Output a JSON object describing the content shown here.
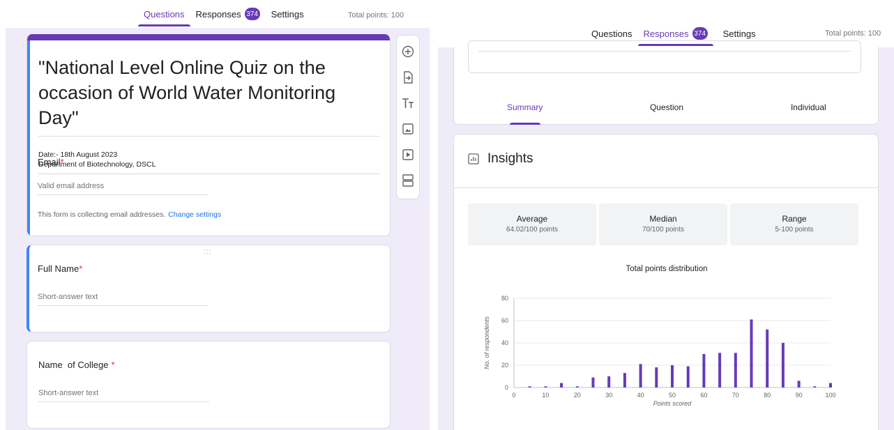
{
  "editor": {
    "tabs": [
      {
        "label": "Questions",
        "active": true
      },
      {
        "label": "Responses",
        "badge": "374",
        "active": false
      },
      {
        "label": "Settings",
        "active": false
      }
    ],
    "total_points": "Total points: 100",
    "form": {
      "title": "\"National Level Online Quiz on the occasion of World Water Monitoring Day\"",
      "description_line1": "Date:- 18th August 2023",
      "description_line2": "Department of Biotechnology, DSCL"
    },
    "email": {
      "label": "Email",
      "required_mark": "*",
      "placeholder": "Valid email address",
      "note": "This form is collecting email addresses.",
      "link": "Change settings"
    },
    "questions": [
      {
        "label": "Full Name",
        "required_mark": "*",
        "placeholder": "Short-answer text"
      },
      {
        "label": "Name  of College",
        "required_mark": "*",
        "placeholder": "Short-answer text"
      }
    ],
    "drag_handle": ":::",
    "toolbar": [
      "add-question-icon",
      "import-questions-icon",
      "add-title-icon",
      "add-image-icon",
      "add-video-icon",
      "add-section-icon"
    ],
    "accent_color": "#673ab7"
  },
  "responses": {
    "tabs": [
      {
        "label": "Questions",
        "active": false
      },
      {
        "label": "Responses",
        "badge": "374",
        "active": true
      },
      {
        "label": "Settings",
        "active": false
      }
    ],
    "total_points": "Total points: 100",
    "subtabs": [
      {
        "label": "Summary",
        "active": true
      },
      {
        "label": "Question",
        "active": false
      },
      {
        "label": "Individual",
        "active": false
      }
    ],
    "insights": {
      "title": "Insights",
      "stats": [
        {
          "label": "Average",
          "value": "64.02/100 points"
        },
        {
          "label": "Median",
          "value": "70/100 points"
        },
        {
          "label": "Range",
          "value": "5-100 points"
        }
      ]
    }
  },
  "chart_data": {
    "type": "bar",
    "title": "Total points distribution",
    "xlabel": "Points scored",
    "ylabel": "No. of respondents",
    "x": [
      5,
      10,
      15,
      20,
      25,
      30,
      35,
      40,
      45,
      50,
      55,
      60,
      65,
      70,
      75,
      80,
      85,
      90,
      95,
      100
    ],
    "values": [
      1,
      1,
      4,
      1,
      9,
      10,
      13,
      21,
      18,
      20,
      19,
      30,
      31,
      31,
      61,
      52,
      40,
      6,
      1,
      4
    ],
    "xlim": [
      0,
      100
    ],
    "ylim": [
      0,
      80
    ],
    "xticks": [
      0,
      10,
      20,
      30,
      40,
      50,
      60,
      70,
      80,
      90,
      100
    ],
    "yticks": [
      0,
      20,
      40,
      60,
      80
    ],
    "bar_color": "#673ab7",
    "grid": true
  }
}
